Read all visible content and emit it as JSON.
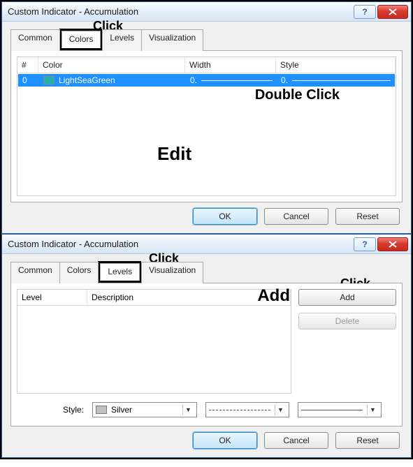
{
  "dialog1": {
    "title": "Custom Indicator - Accumulation",
    "tabs": {
      "common": "Common",
      "colors": "Colors",
      "levels": "Levels",
      "visualization": "Visualization",
      "active": "Colors"
    },
    "table": {
      "headers": {
        "idx": "#",
        "color": "Color",
        "width": "Width",
        "style": "Style"
      },
      "row": {
        "idx": "0",
        "color_name": "LightSeaGreen",
        "color_hex": "#20b2aa",
        "width_display": "0.",
        "style_display": "0."
      }
    },
    "annotations": {
      "click": "Click",
      "double_click": "Double Click",
      "edit": "Edit"
    },
    "buttons": {
      "ok": "OK",
      "cancel": "Cancel",
      "reset": "Reset"
    }
  },
  "dialog2": {
    "title": "Custom Indicator - Accumulation",
    "tabs": {
      "common": "Common",
      "colors": "Colors",
      "levels": "Levels",
      "visualization": "Visualization",
      "active": "Levels"
    },
    "list": {
      "headers": {
        "level": "Level",
        "description": "Description"
      }
    },
    "side_buttons": {
      "add": "Add",
      "delete": "Delete"
    },
    "annotations": {
      "click_tab": "Click",
      "click_add": "Click",
      "add_big": "Add"
    },
    "style_row": {
      "label": "Style:",
      "color_name": "Silver",
      "color_hex": "#c0c0c0"
    },
    "buttons": {
      "ok": "OK",
      "cancel": "Cancel",
      "reset": "Reset"
    }
  }
}
